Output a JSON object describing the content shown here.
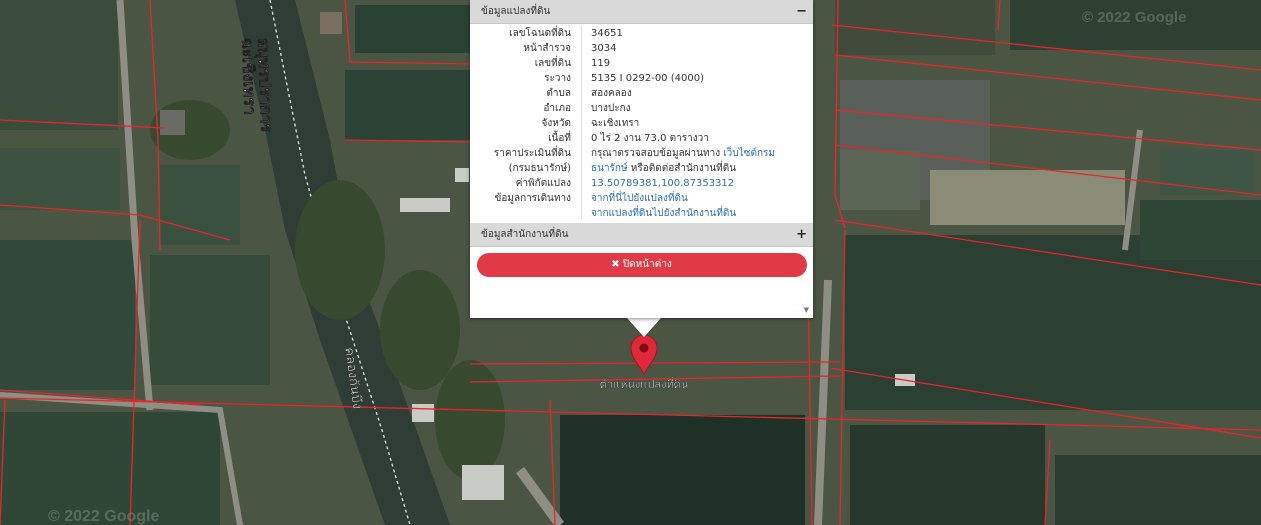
{
  "map": {
    "watermark_top": "© 2022 Google",
    "watermark_bottom": "© 2022 Google",
    "road_label_1": "ฉะเชิงเทรา",
    "road_label_2": "สมุทรปราการ",
    "canal_label": "คลองกันบึง",
    "marker_label": "ตำแหน่งแปลงที่ดิน"
  },
  "popup": {
    "section1_title": "ข้อมูลแปลงที่ดิน",
    "section1_toggle": "−",
    "rows": [
      {
        "label": "เลขโฉนดที่ดิน",
        "value": "34651"
      },
      {
        "label": "หน้าสำรวจ",
        "value": "3034"
      },
      {
        "label": "เลขที่ดิน",
        "value": "119"
      },
      {
        "label": "ระวาง",
        "value": "5135 I 0292-00 (4000)"
      },
      {
        "label": "ตำบล",
        "value": "สองคลอง"
      },
      {
        "label": "อำเภอ",
        "value": "บางปะกง"
      },
      {
        "label": "จังหวัด",
        "value": "ฉะเชิงเทรา"
      },
      {
        "label": "เนื้อที่",
        "value": "0 ไร่ 2 งาน 73.0 ตารางวา"
      }
    ],
    "price": {
      "label1": "ราคาประเมินที่ดิน",
      "label2": "(กรมธนารักษ์)",
      "text1": "กรุณาตรวจสอบข้อมูลผ่านทาง",
      "link1": "เว็บไซต์กรม",
      "link2": "ธนารักษ์",
      "text2": "หรือติดต่อสำนักงานที่ดิน"
    },
    "coords": {
      "label": "ค่าพิกัดแปลง",
      "value": "13.50789381,100.87353312"
    },
    "route": {
      "label": "ข้อมูลการเดินทาง",
      "link1": "จากที่นี่ไปยังแปลงที่ดิน",
      "link2": "จากแปลงที่ดินไปยังสำนักงานที่ดิน"
    },
    "section2_title": "ข้อมูลสำนักงานที่ดิน",
    "section2_toggle": "+",
    "close_label": "✖ ปิดหน้าต่าง",
    "scroll_arrow": "▼"
  },
  "colors": {
    "close_button": "#e13a47",
    "marker": "#e0283a",
    "parcel_lines": "#e8242c",
    "link": "#2a6fb5"
  }
}
